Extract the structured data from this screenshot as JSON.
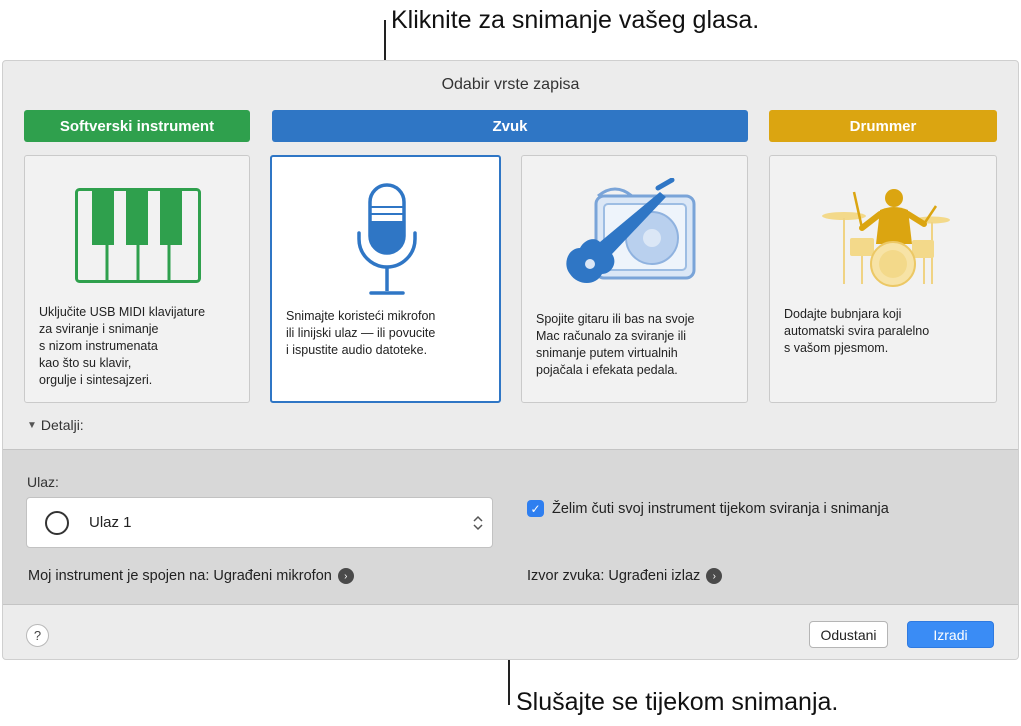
{
  "callouts": {
    "top": "Kliknite za snimanje vašeg glasa.",
    "bottom": "Slušajte se tijekom snimanja."
  },
  "window": {
    "title": "Odabir vrste zapisa"
  },
  "categories": [
    {
      "label": "Softverski instrument",
      "color": "#2fa04d"
    },
    {
      "label": "Zvuk",
      "color": "#2f76c5"
    },
    {
      "label": "Drummer",
      "color": "#dba511"
    }
  ],
  "cards": [
    {
      "icon": "piano-keyboard-icon",
      "description": "Uključite USB MIDI klavijature\nza sviranje i snimanje\ns nizom instrumenata\nkao što su klavir,\norgulje i sintesajzeri.",
      "selected": false
    },
    {
      "icon": "microphone-icon",
      "description": "Snimajte koristeći mikrofon\nili linijski ulaz — ili povucite\ni ispustite audio datoteke.",
      "selected": true
    },
    {
      "icon": "guitar-amp-icon",
      "description": "Spojite gitaru ili bas na svoje\nMac računalo za sviranje ili\nsnimanje putem virtualnih\npojačala i efekata pedala.",
      "selected": false
    },
    {
      "icon": "drummer-icon",
      "description": "Dodajte bubnjara koji\nautomatski svira paralelno\ns vašom pjesmom.",
      "selected": false
    }
  ],
  "details": {
    "label": "Detalji:",
    "input_label": "Ulaz:",
    "input_value": "Ulaz 1",
    "monitor_label": "Želim čuti svoj instrument tijekom sviranja i snimanja",
    "monitor_checked": true,
    "instrument_connection": "Moj instrument je spojen na: Ugrađeni mikrofon",
    "output_source": "Izvor zvuka: Ugrađeni izlaz"
  },
  "footer": {
    "help": "?",
    "cancel": "Odustani",
    "create": "Izradi"
  }
}
